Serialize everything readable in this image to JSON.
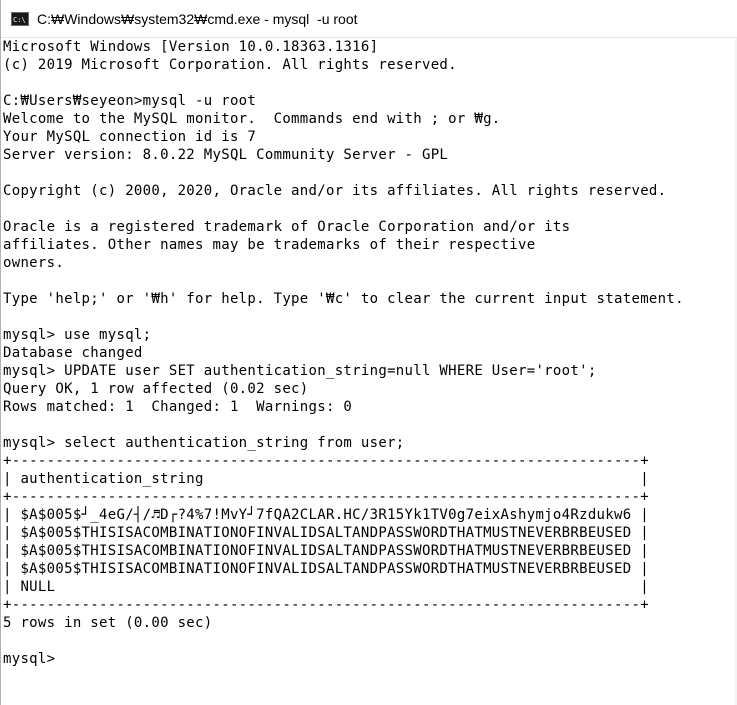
{
  "window": {
    "title": "C:₩Windows₩system32₩cmd.exe - mysql  -u root",
    "icon": "cmd-icon",
    "icon_text": "C:\\"
  },
  "console": {
    "lines": [
      "Microsoft Windows [Version 10.0.18363.1316]",
      "(c) 2019 Microsoft Corporation. All rights reserved.",
      "",
      "C:₩Users₩seyeon>mysql -u root",
      "Welcome to the MySQL monitor.  Commands end with ; or ₩g.",
      "Your MySQL connection id is 7",
      "Server version: 8.0.22 MySQL Community Server - GPL",
      "",
      "Copyright (c) 2000, 2020, Oracle and/or its affiliates. All rights reserved.",
      "",
      "Oracle is a registered trademark of Oracle Corporation and/or its",
      "affiliates. Other names may be trademarks of their respective",
      "owners.",
      "",
      "Type 'help;' or '₩h' for help. Type '₩c' to clear the current input statement.",
      "",
      "mysql> use mysql;",
      "Database changed",
      "mysql> UPDATE user SET authentication_string=null WHERE User='root';",
      "Query OK, 1 row affected (0.02 sec)",
      "Rows matched: 1  Changed: 1  Warnings: 0",
      "",
      "mysql> select authentication_string from user;",
      "+------------------------------------------------------------------------+",
      "| authentication_string                                                  |",
      "+------------------------------------------------------------------------+",
      "| $A$005$┘_4eG/┤/♬D┌?4%7!MvY┘7fQA2CLAR.HC/3R15Yk1TV0g7eixAshymjo4Rzdukw6 |",
      "| $A$005$THISISACOMBINATIONOFINVALIDSALTANDPASSWORDTHATMUSTNEVERBRBEUSED |",
      "| $A$005$THISISACOMBINATIONOFINVALIDSALTANDPASSWORDTHATMUSTNEVERBRBEUSED |",
      "| $A$005$THISISACOMBINATIONOFINVALIDSALTANDPASSWORDTHATMUSTNEVERBRBEUSED |",
      "| NULL                                                                   |",
      "+------------------------------------------------------------------------+",
      "5 rows in set (0.00 sec)",
      "",
      "mysql>"
    ]
  }
}
